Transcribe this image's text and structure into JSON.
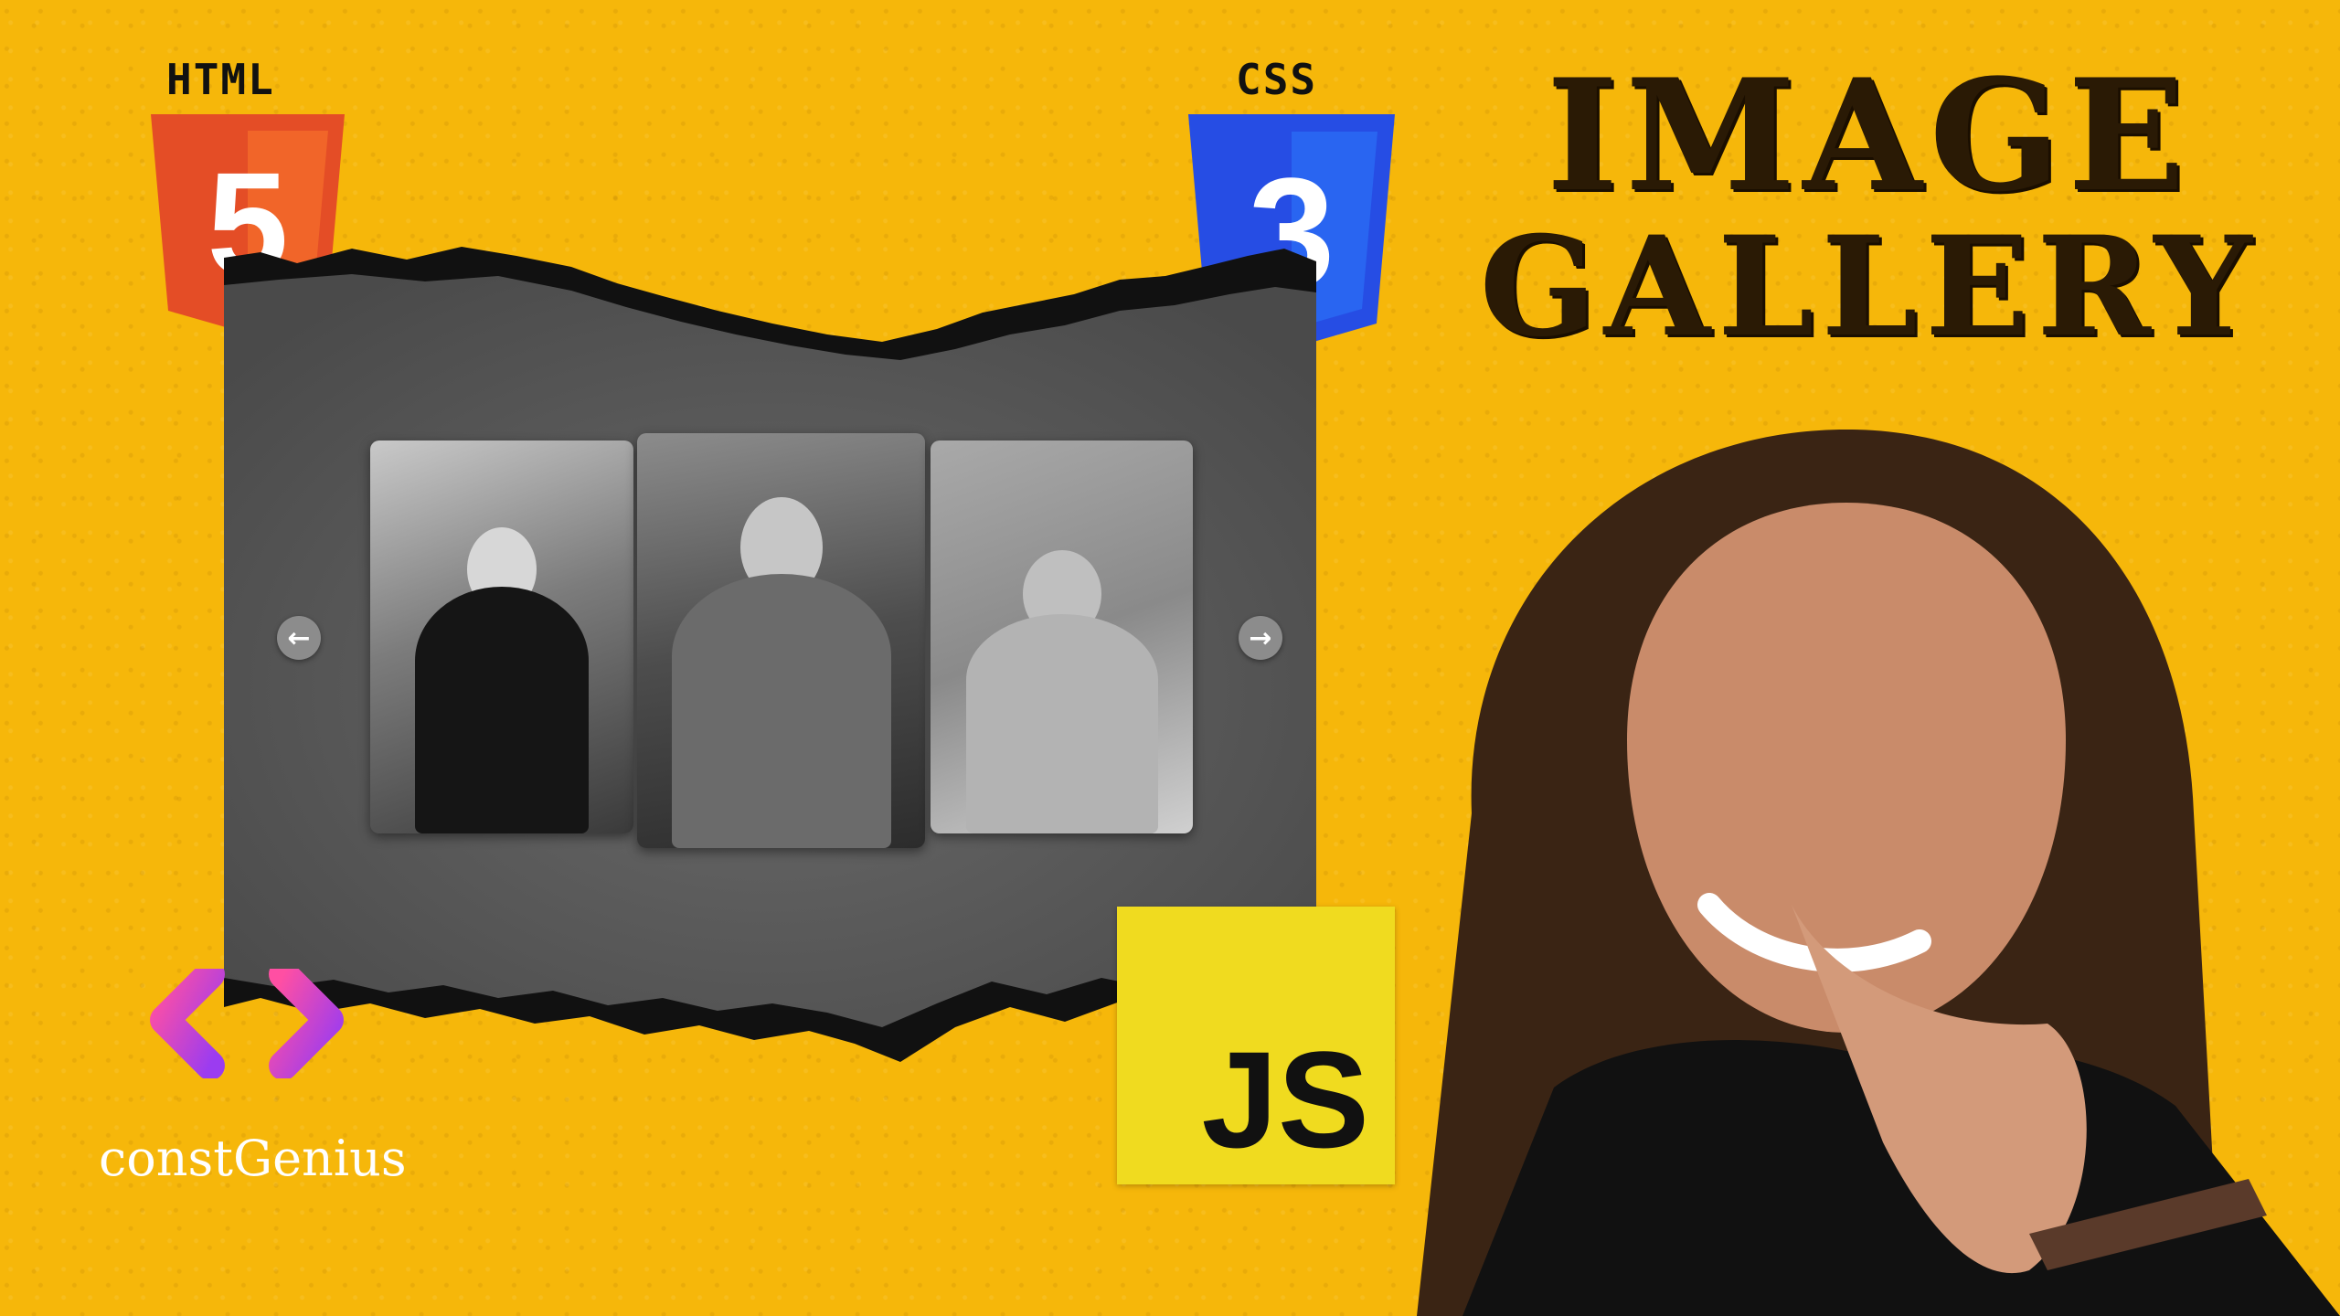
{
  "logos": {
    "html_label": "HTML",
    "html_digit": "5",
    "css_label": "CSS",
    "css_digit": "3",
    "js_label": "JS"
  },
  "title": {
    "line1": "IMAGE",
    "line2": "GALLERY"
  },
  "brand": {
    "name": "constGenius"
  },
  "gallery": {
    "prev_icon": "←",
    "next_icon": "→",
    "images": [
      "photo-woman-coat",
      "photo-woman-saree",
      "photo-woman-sunglasses"
    ]
  },
  "colors": {
    "background": "#f6b70a",
    "html_orange": "#e44d26",
    "css_blue": "#264de4",
    "js_yellow": "#f0db1f",
    "card_gray": "#5a5a5a"
  }
}
